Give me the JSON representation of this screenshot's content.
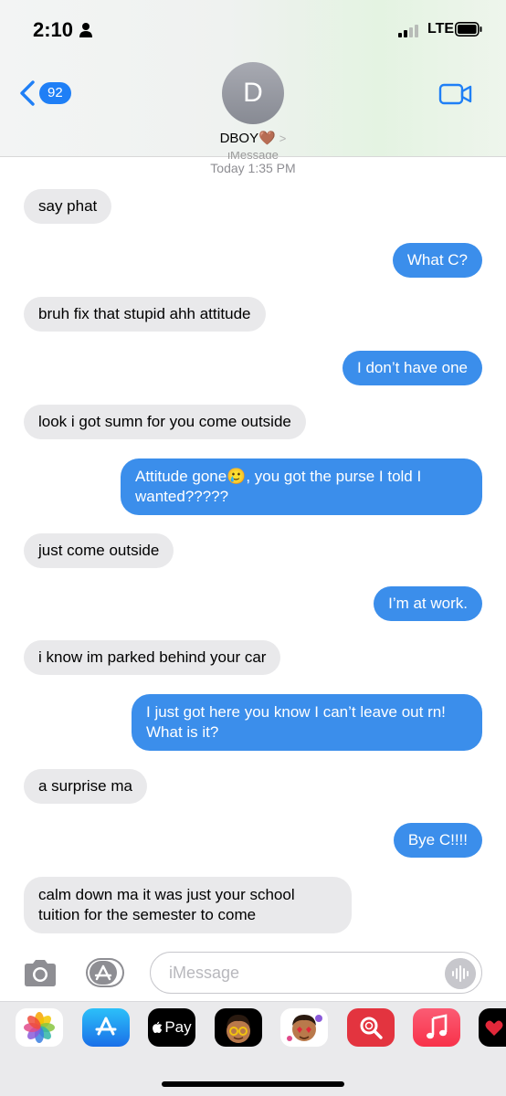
{
  "status_bar": {
    "time": "2:10",
    "network": "LTE"
  },
  "header": {
    "back_count": "92",
    "avatar_initial": "D",
    "contact_name": "DBOY",
    "contact_emoji": "🤎",
    "chevron": ">"
  },
  "thread": {
    "service_label": "iMessage",
    "timestamp": "Today 1:35 PM",
    "messages": [
      {
        "from": "them",
        "text": "say phat"
      },
      {
        "from": "me",
        "text": "What C?"
      },
      {
        "from": "them",
        "text": "bruh fix that stupid ahh attitude"
      },
      {
        "from": "me",
        "text": "I don’t have one"
      },
      {
        "from": "them",
        "text": "look i got sumn for you come outside"
      },
      {
        "from": "me",
        "text": "Attitude gone🥲, you got the purse I told I wanted?????"
      },
      {
        "from": "them",
        "text": "just come outside"
      },
      {
        "from": "me",
        "text": "I’m at work."
      },
      {
        "from": "them",
        "text": "i know im parked behind your car"
      },
      {
        "from": "me",
        "text": "I just got here you know I can’t leave out rn! What is it?"
      },
      {
        "from": "them",
        "text": "a surprise ma"
      },
      {
        "from": "me",
        "text": "Bye C!!!!"
      },
      {
        "from": "them",
        "text": "calm down ma it was just your school tuition for the semester to come"
      }
    ]
  },
  "composer": {
    "placeholder": "iMessage"
  },
  "app_drawer": {
    "apps": [
      {
        "name": "Photos",
        "icon": "photos-icon"
      },
      {
        "name": "App Store",
        "icon": "app-store-icon"
      },
      {
        "name": "Apple Pay",
        "icon": "apple-pay-icon",
        "label": "Pay"
      },
      {
        "name": "Memoji",
        "icon": "memoji-icon"
      },
      {
        "name": "Memoji Stickers",
        "icon": "memoji-stickers-icon"
      },
      {
        "name": "Search Images",
        "icon": "search-images-icon"
      },
      {
        "name": "Music",
        "icon": "music-icon"
      },
      {
        "name": "Digital Touch",
        "icon": "digital-touch-icon"
      }
    ]
  },
  "colors": {
    "outgoing_bubble": "#3b8eeb",
    "incoming_bubble": "#e9e9eb",
    "accent": "#1f7ff6"
  }
}
